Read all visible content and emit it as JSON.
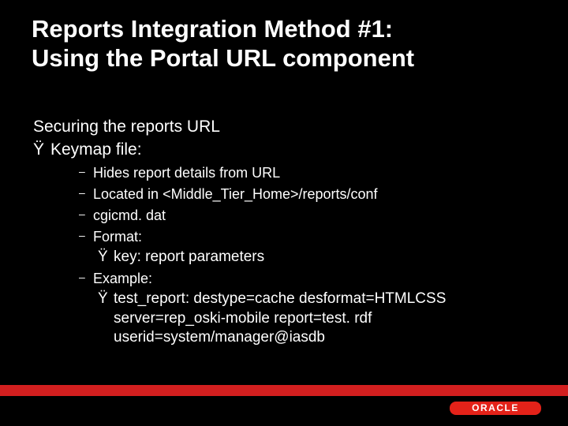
{
  "title_line1": "Reports Integration Method #1:",
  "title_line2": "Using the Portal URL component",
  "body": {
    "intro": "Securing the reports URL",
    "bullet_char": "Ÿ",
    "dash_char": "–",
    "keymap_label": "Keymap file:",
    "items": [
      "Hides report details from URL",
      "Located in <Middle_Tier_Home>/reports/conf",
      "cgicmd. dat",
      "Format:"
    ],
    "format_sub": "key: report parameters",
    "example_label": "Example:",
    "example_text": "test_report: destype=cache desformat=HTMLCSS server=rep_oski-mobile report=test. rdf userid=system/manager@iasdb"
  },
  "logo_text": "ORACLE"
}
